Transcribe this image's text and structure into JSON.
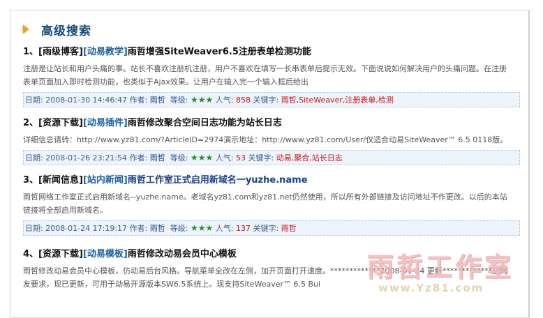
{
  "header": {
    "title": "高级搜索"
  },
  "articles": [
    {
      "num": "1、",
      "category": "[雨级博客]",
      "subcategory": "[动易教学]",
      "title": "雨哲增强SiteWeaver6.5注册表单检测功能",
      "desc": "注册是让站长和用户头痛的事。站长不喜欢注册机注册，用户不喜欢在填写一长串表单后提示无效。下面说说如何解决用户的头痛问题。在注册表单页面加入即时检测功能，也类似于Ajax效果。让用户在输入完一个输入框后给出",
      "date_label": "日期:",
      "date": "2008-01-30 14:46:47",
      "author_label": "作者:",
      "author": "雨哲",
      "grade_label": "等级:",
      "stars": "★★★",
      "pop_label": "人气:",
      "pop": "858",
      "kw_label": "关键字:",
      "keywords": "雨哲,SiteWeaver,注册表单,检测"
    },
    {
      "num": "2、",
      "category": "[资源下载]",
      "subcategory": "[动易插件]",
      "title": "雨哲修改聚合空间日志功能为站长日志",
      "desc": "详细信息请转：http://www.yz81.com/?ArticleID=2974演示地址：http://www.yz81.com/User/仅适合动易SiteWeaver™ 6.5 0118版。",
      "date_label": "日期:",
      "date": "2008-01-26 23:21:54",
      "author_label": "作者:",
      "author": "雨哲",
      "grade_label": "等级:",
      "stars": "★★★",
      "pop_label": "人气:",
      "pop": "53",
      "kw_label": "关键字:",
      "keywords": "动易,聚合,站长日志"
    },
    {
      "num": "3、",
      "category": "[新闻信息]",
      "subcategory": "[站内新闻]",
      "title": "雨哲工作室正式启用新域名一yuzhe.name",
      "desc": "雨哲网络工作室正式启用新域名--yuzhe.name。老域名yz81.com和yz81.net仍然使用，所以所有外部链接及访问地址不作更改。以后的本站链接将全部启用新域名。",
      "date_label": "日期:",
      "date": "2008-01-24 17:19:17",
      "author_label": "作者:",
      "author": "雨哲",
      "grade_label": "等级:",
      "stars": "★★★",
      "pop_label": "人气:",
      "pop": "137",
      "kw_label": "关键字:",
      "keywords": "雨哲"
    },
    {
      "num": "4、",
      "category": "[资源下载]",
      "subcategory": "[动易模板]",
      "title": "雨哲修改动易会员中心模板",
      "desc": "雨哲修改动易会员中心模板，仿动易后台风格。导航菜单全改在左侧，加开页面打开速度。*************2008-01-24 更新*************应网友要求，现已更新，可用于动易开源版本SW6.5系统上。现支持SiteWeaver™ 6.5 Bui"
    }
  ],
  "watermark": {
    "text": "雨哲工作室",
    "url": "www.Yz81.com"
  }
}
